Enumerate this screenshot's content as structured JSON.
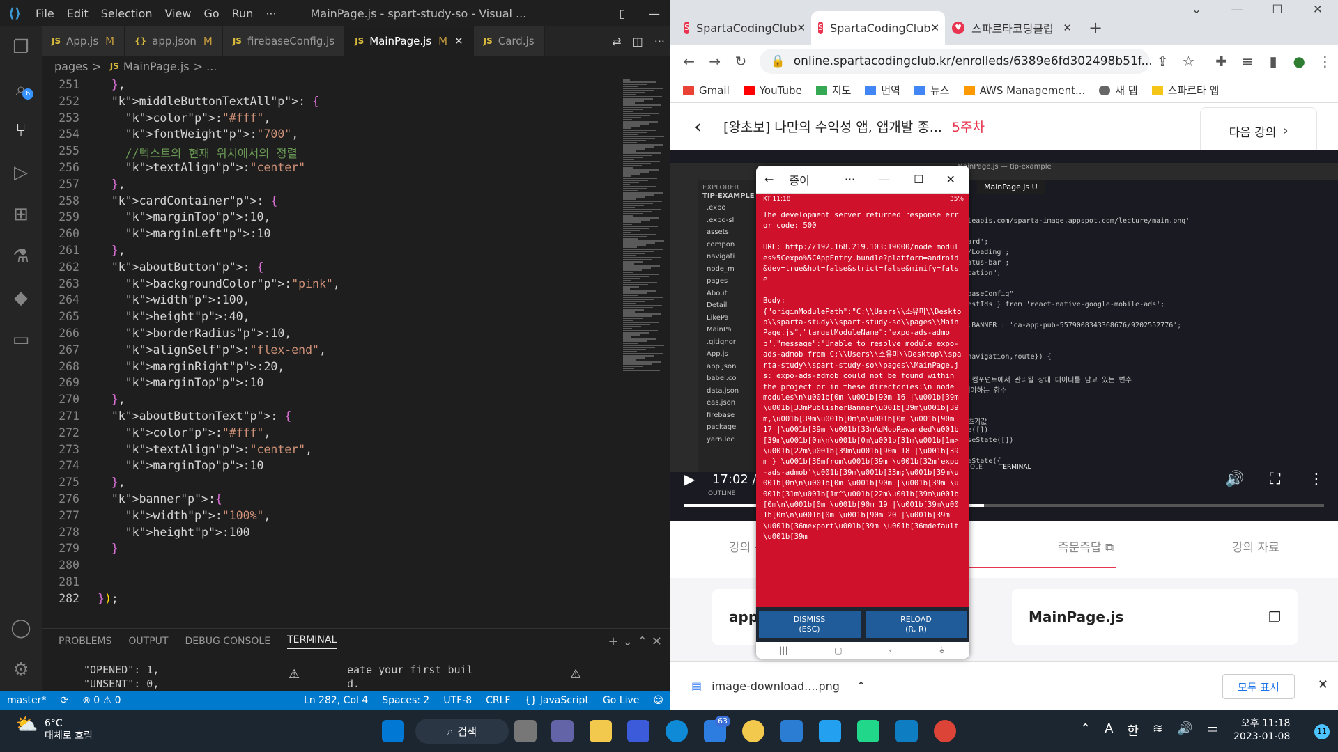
{
  "vscode": {
    "menu": [
      "File",
      "Edit",
      "Selection",
      "View",
      "Go",
      "Run",
      "···"
    ],
    "window_title": "MainPage.js - spart-study-so - Visual ...",
    "tabs": [
      {
        "icon": "JS",
        "label": "App.js",
        "mod": "M"
      },
      {
        "icon": "{}",
        "label": "app.json",
        "mod": "M"
      },
      {
        "icon": "JS",
        "label": "firebaseConfig.js",
        "mod": ""
      },
      {
        "icon": "JS",
        "label": "MainPage.js",
        "mod": "M"
      },
      {
        "icon": "JS",
        "label": "Card.js",
        "mod": ""
      }
    ],
    "breadcrumb": {
      "folder": "pages",
      "sep": ">",
      "file": "MainPage.js",
      "more": "> ..."
    },
    "scm_badge": "6",
    "code": [
      {
        "n": "251",
        "t": "  },"
      },
      {
        "n": "252",
        "t": "  middleButtonTextAll: {"
      },
      {
        "n": "253",
        "t": "    color:\"#fff\","
      },
      {
        "n": "254",
        "t": "    fontWeight:\"700\","
      },
      {
        "n": "255",
        "t": "    //텍스트의 현재 위치에서의 정렬"
      },
      {
        "n": "256",
        "t": "    textAlign:\"center\""
      },
      {
        "n": "257",
        "t": "  },"
      },
      {
        "n": "258",
        "t": "  cardContainer: {"
      },
      {
        "n": "259",
        "t": "    marginTop:10,"
      },
      {
        "n": "260",
        "t": "    marginLeft:10"
      },
      {
        "n": "261",
        "t": "  },"
      },
      {
        "n": "262",
        "t": "  aboutButton: {"
      },
      {
        "n": "263",
        "t": "    backgroundColor:\"pink\","
      },
      {
        "n": "264",
        "t": "    width:100,"
      },
      {
        "n": "265",
        "t": "    height:40,"
      },
      {
        "n": "266",
        "t": "    borderRadius:10,"
      },
      {
        "n": "267",
        "t": "    alignSelf:\"flex-end\","
      },
      {
        "n": "268",
        "t": "    marginRight:20,"
      },
      {
        "n": "269",
        "t": "    marginTop:10"
      },
      {
        "n": "270",
        "t": "  },"
      },
      {
        "n": "271",
        "t": "  aboutButtonText: {"
      },
      {
        "n": "272",
        "t": "    color:\"#fff\","
      },
      {
        "n": "273",
        "t": "    textAlign:\"center\","
      },
      {
        "n": "274",
        "t": "    marginTop:10"
      },
      {
        "n": "275",
        "t": "  },"
      },
      {
        "n": "276",
        "t": "  banner:{"
      },
      {
        "n": "277",
        "t": "    width:\"100%\","
      },
      {
        "n": "278",
        "t": "    height:100"
      },
      {
        "n": "279",
        "t": "  }"
      },
      {
        "n": "280",
        "t": ""
      },
      {
        "n": "281",
        "t": ""
      },
      {
        "n": "282",
        "t": "});"
      }
    ],
    "panel_tabs": [
      "PROBLEMS",
      "OUTPUT",
      "DEBUG CONSOLE",
      "TERMINAL"
    ],
    "terminal_left": "\"OPENED\": 1,\n\"UNSENT\": 0,",
    "terminal_right": "eate your first buil\nd.",
    "status": {
      "branch": "master*",
      "problems": "⊗ 0 ⚠ 0",
      "position": "Ln 282, Col 4",
      "spaces": "Spaces: 2",
      "encoding": "UTF-8",
      "eol": "CRLF",
      "language": "{} JavaScript",
      "golive": "Go Live"
    }
  },
  "chrome": {
    "tabs": [
      {
        "label": "SpartaCodingClub"
      },
      {
        "label": "SpartaCodingClub"
      },
      {
        "label": "스파르타코딩클럽"
      }
    ],
    "url": "online.spartacodingclub.kr/enrolleds/6389e6fd302498b51f...",
    "bookmarks": [
      "Gmail",
      "YouTube",
      "지도",
      "번역",
      "뉴스",
      "AWS Management...",
      "새 탭",
      "스파르타 앱"
    ],
    "page_title": "[왕초보] 나만의 수익성 앱, 앱개발 종...",
    "week": "5주차",
    "next_lecture": "다음 강의",
    "video_time": "17:02 /",
    "video_explorer_title": "EXPLORER",
    "video_project": "TIP-EXAMPLE",
    "video_tree": [
      ".expo",
      ".expo-sl",
      "assets",
      "compon",
      "navigati",
      "node_m",
      "pages",
      "About",
      "Detail",
      "LikePa",
      "MainPa",
      ".gitignor",
      "App.js",
      "app.json",
      "babel.co",
      "data.json",
      "eas.json",
      "firebase",
      "package",
      "yarn.loc"
    ],
    "video_tab": "MainPage.js U",
    "video_code": [
      "torage.googleapis.com/sparta-image.appspot.com/lecture/main.png'",
      "a.json';",
      "omponents/Card';",
      "/components/Loading';",
      "om 'expo-status-bar';",
      "om \"expo-location\";",
      "",
      "om \"../firebaseConfig\"",
      "erAdSize, TestIds } from 'react-native-google-mobile-ads';",
      "",
      "_ ? TestIds.BANNER : 'ca-app-pub-5579008343368676/9202552776';",
      "",
      "",
      " MainPage({navigation,route}) {",
      "",
      "] state는 이 컴포넌트에서 관리될 상태 데이터를 담고 있는 변수",
      "경시킬때 사용해야하는 함수",
      "",
      "해줌",
      " 같은 state 초기값",
      "] = useState([])",
      "eState] = useState([])",
      "생성!",
      "ather] = useState({"
    ],
    "video_terminal_tabs": [
      "OLE",
      "TERMINAL"
    ],
    "video_outline": "OUTLINE",
    "lecture_tabs": [
      "강의 목",
      "즉문즉답",
      "강의 자료"
    ],
    "cards": [
      "app.",
      "MainPage.js"
    ],
    "download_file": "image-download....png",
    "show_all": "모두 표시"
  },
  "emulator": {
    "title": "종이",
    "status": "KT 11:18",
    "battery": "35%",
    "error": "The development server returned response error code: 500\n\nURL: http://192.168.219.103:19000/node_modules%5Cexpo%5CAppEntry.bundle?platform=android&dev=true&hot=false&strict=false&minify=false\n\nBody:\n{\"originModulePath\":\"C:\\\\Users\\\\소유미\\\\Desktop\\\\sparta-study\\\\spart-study-so\\\\pages\\\\MainPage.js\",\"targetModuleName\":\"expo-ads-admob\",\"message\":\"Unable to resolve module expo-ads-admob from C:\\\\Users\\\\소유미\\\\Desktop\\\\sparta-study\\\\spart-study-so\\\\pages\\\\MainPage.js: expo-ads-admob could not be found within the project or in these directories:\\n node_modules\\n\\u001b[0m \\u001b[90m 16 |\\u001b[39m \\u001b[33mPublisherBanner\\u001b[39m\\u001b[39m,\\u001b[39m\\u001b[0m\\n\\u001b[0m \\u001b[90m 17 |\\u001b[39m \\u001b[33mAdMobRewarded\\u001b[39m\\u001b[0m\\n\\u001b[0m\\u001b[31m\\u001b[1m>\\u001b[22m\\u001b[39m\\u001b[90m 18 |\\u001b[39m } \\u001b[36mfrom\\u001b[39m \\u001b[32m'expo-ads-admob'\\u001b[39m\\u001b[33m;\\u001b[39m\\u001b[0m\\n\\u001b[0m \\u001b[90m |\\u001b[39m \\u001b[31m\\u001b[1m^\\u001b[22m\\u001b[39m\\u001b[0m\\n\\u001b[0m \\u001b[90m 19 |\\u001b[39m\\u001b[0m\\n\\u001b[0m \\u001b[90m 20 |\\u001b[39m \\u001b[36mexport\\u001b[39m \\u001b[36mdefault\\u001b[39m",
    "dismiss": "DISMISS\n(ESC)",
    "reload": "RELOAD\n(R, R)"
  },
  "taskbar": {
    "temp": "6°C",
    "weather": "대체로 흐림",
    "search": "검색",
    "badge": "63",
    "ime1": "A",
    "ime2": "한",
    "time": "오후 11:18",
    "date": "2023-01-08",
    "notif": "11"
  }
}
